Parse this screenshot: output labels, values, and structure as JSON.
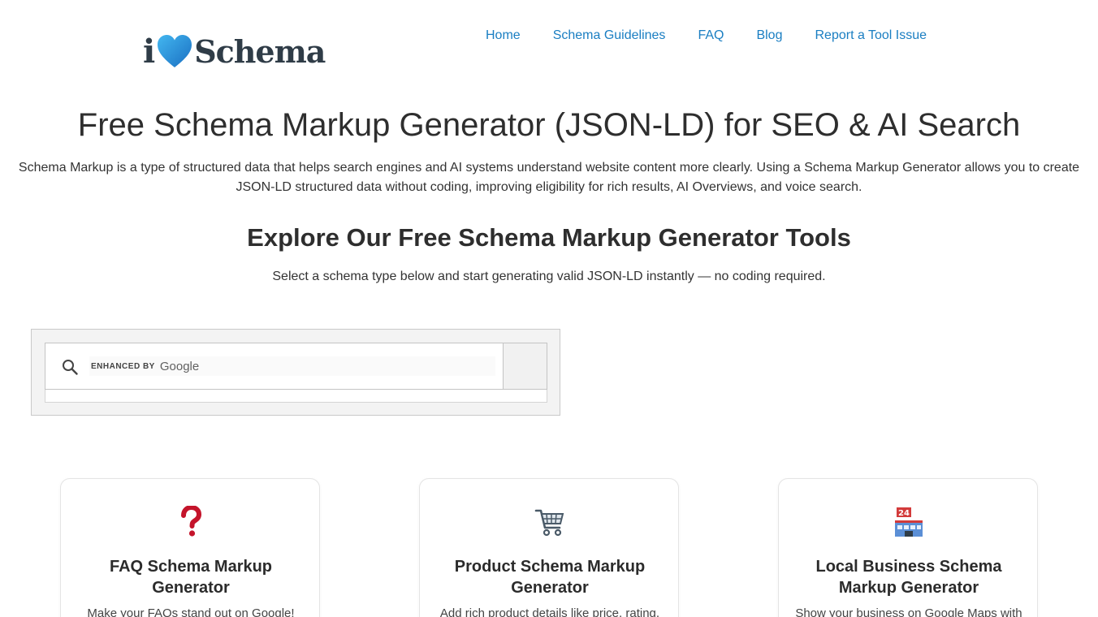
{
  "header": {
    "logo": {
      "letter": "i",
      "word": "Schema",
      "heart_color": "#2b9fe0"
    },
    "nav": [
      {
        "label": "Home"
      },
      {
        "label": "Schema Guidelines"
      },
      {
        "label": "FAQ"
      },
      {
        "label": "Blog"
      },
      {
        "label": "Report a Tool Issue"
      }
    ]
  },
  "hero": {
    "title": "Free Schema Markup Generator (JSON-LD) for SEO & AI Search",
    "description": "Schema Markup is a type of structured data that helps search engines and AI systems understand website content more clearly. Using a Schema Markup Generator allows you to create JSON-LD structured data without coding, improving eligibility for rich results, AI Overviews, and voice search."
  },
  "tools_section": {
    "title": "Explore Our Free Schema Markup Generator Tools",
    "subtitle": "Select a schema type below and start generating valid JSON-LD instantly — no coding required."
  },
  "search": {
    "enhanced_label": "ENHANCED BY",
    "provider": "Google",
    "icon": "search-icon"
  },
  "cards": [
    {
      "icon": "question-mark-icon",
      "icon_color": "#c4142b",
      "title": "FAQ Schema Markup Generator",
      "description": "Make your FAQs stand out on Google!"
    },
    {
      "icon": "shopping-cart-icon",
      "icon_color": "#4a5a68",
      "title": "Product Schema Markup Generator",
      "description": "Add rich product details like price, rating,"
    },
    {
      "icon": "convenience-store-icon",
      "icon_color": "#d33b3b",
      "title": "Local Business Schema Markup Generator",
      "description": "Show your business on Google Maps with"
    }
  ],
  "colors": {
    "link": "#1a7ec2",
    "text": "#2b2b2b",
    "logo_text": "#2f3c47"
  }
}
